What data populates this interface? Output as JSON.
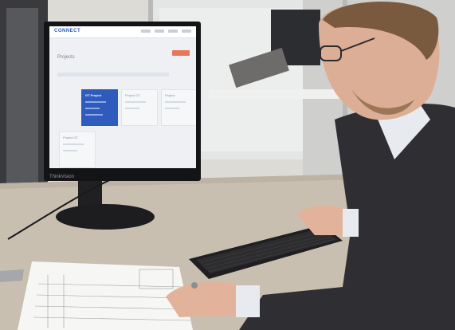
{
  "screen": {
    "logo": "CONNECT",
    "page_title": "Projects",
    "active_card_title": "GT Project",
    "card_titles": [
      "Project GT",
      "Project",
      "Project GT"
    ]
  },
  "colors": {
    "brand_blue": "#2f5bbd",
    "accent_orange": "#e8765a",
    "desk": "#c8bfb1",
    "jacket": "#2f2e33"
  }
}
